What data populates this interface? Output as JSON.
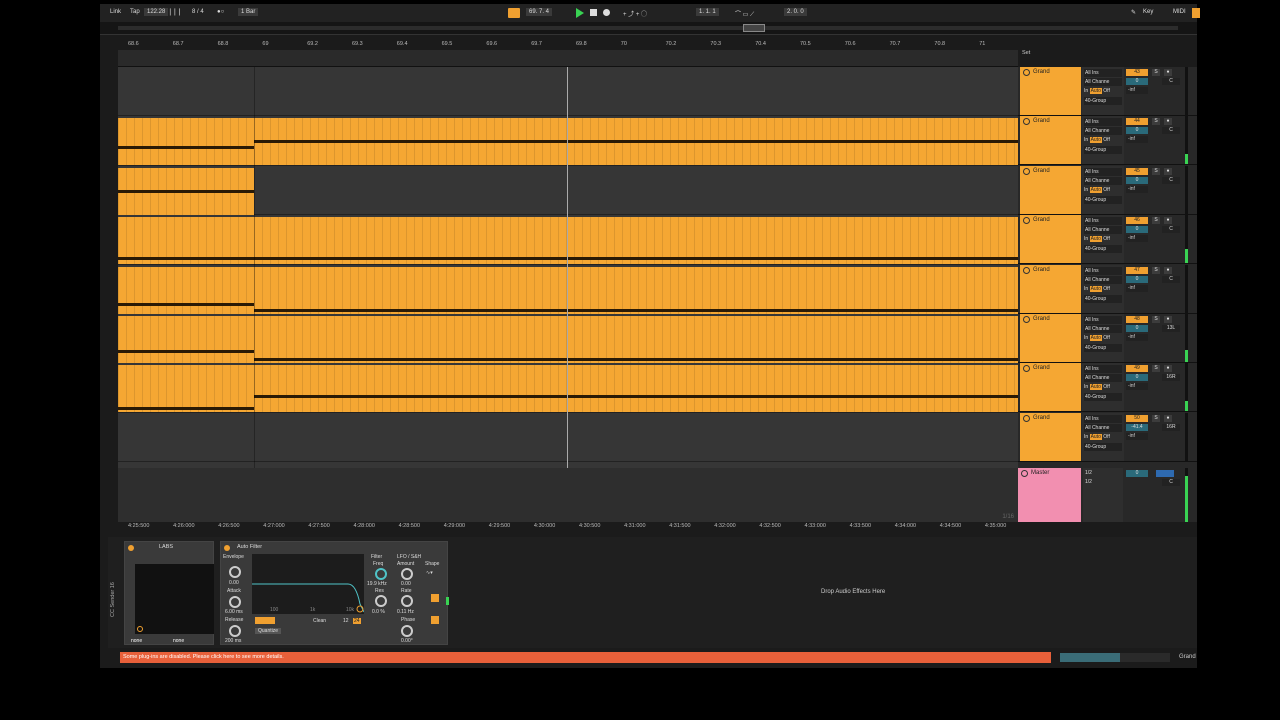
{
  "control_bar": {
    "link": "Link",
    "tap": "Tap",
    "tempo": "122.28",
    "meter_icon": "metronome-icon",
    "time_sig": "8 / 4",
    "quantize": "1 Bar",
    "position": "69.  7.  4",
    "loop_start": "1.  1.  1",
    "loop_len": "2.  0.  0",
    "key": "Key",
    "midi": "MIDI"
  },
  "ruler": {
    "ticks": [
      "68.6",
      "68.7",
      "68.8",
      "69",
      "69.2",
      "69.3",
      "69.4",
      "69.5",
      "69.6",
      "69.7",
      "69.8",
      "70",
      "70.2",
      "70.3",
      "70.4",
      "70.5",
      "70.6",
      "70.7",
      "70.8",
      "71"
    ]
  },
  "time_ruler": {
    "ticks": [
      "4:25:500",
      "4:26:000",
      "4:26:500",
      "4:27:000",
      "4:27:500",
      "4:28:000",
      "4:28:500",
      "4:29:000",
      "4:29:500",
      "4:30:000",
      "4:30:500",
      "4:31:000",
      "4:31:500",
      "4:32:000",
      "4:32:500",
      "4:33:000",
      "4:33:500",
      "4:34:000",
      "4:34:500",
      "4:35:000"
    ]
  },
  "set_label": "Set",
  "tracks": [
    {
      "name": "Grand",
      "input": "All Ins",
      "channel": "All Channe",
      "monitor_in": "In",
      "monitor_auto": "Auto",
      "monitor_off": "Off",
      "output": "40-Group",
      "number": "43",
      "volume": "0",
      "send": "-inf",
      "pan": "C"
    },
    {
      "name": "Grand",
      "input": "All Ins",
      "channel": "All Channe",
      "monitor_in": "In",
      "monitor_auto": "Auto",
      "monitor_off": "Off",
      "output": "40-Group",
      "number": "44",
      "volume": "0",
      "send": "-inf",
      "pan": "C"
    },
    {
      "name": "Grand",
      "input": "All Ins",
      "channel": "All Channe",
      "monitor_in": "In",
      "monitor_auto": "Auto",
      "monitor_off": "Off",
      "output": "40-Group",
      "number": "45",
      "volume": "0",
      "send": "-inf",
      "pan": "C"
    },
    {
      "name": "Grand",
      "input": "All Ins",
      "channel": "All Channe",
      "monitor_in": "In",
      "monitor_auto": "Auto",
      "monitor_off": "Off",
      "output": "40-Group",
      "number": "46",
      "volume": "0",
      "send": "-inf",
      "pan": "C"
    },
    {
      "name": "Grand",
      "input": "All Ins",
      "channel": "All Channe",
      "monitor_in": "In",
      "monitor_auto": "Auto",
      "monitor_off": "Off",
      "output": "40-Group",
      "number": "47",
      "volume": "0",
      "send": "-inf",
      "pan": "C"
    },
    {
      "name": "Grand",
      "input": "All Ins",
      "channel": "All Channe",
      "monitor_in": "In",
      "monitor_auto": "Auto",
      "monitor_off": "Off",
      "output": "40-Group",
      "number": "48",
      "volume": "0",
      "send": "-inf",
      "pan": "13L"
    },
    {
      "name": "Grand",
      "input": "All Ins",
      "channel": "All Channe",
      "monitor_in": "In",
      "monitor_auto": "Auto",
      "monitor_off": "Off",
      "output": "40-Group",
      "number": "49",
      "volume": "0",
      "send": "-inf",
      "pan": "16R"
    },
    {
      "name": "Grand",
      "input": "All Ins",
      "channel": "All Channe",
      "monitor_in": "In",
      "monitor_auto": "Auto",
      "monitor_off": "Off",
      "output": "40-Group",
      "number": "50",
      "volume": "-41.4",
      "send": "-inf",
      "pan": "16R"
    }
  ],
  "master": {
    "name": "Master",
    "out1": "1/2",
    "out2": "1/2",
    "volume": "0",
    "pan": "C",
    "page": "1/16"
  },
  "devices": {
    "labs": {
      "title": "LABS",
      "sel1": "none",
      "sel2": "none"
    },
    "side_label": "CC Sender 16",
    "auto_filter": {
      "title": "Auto Filter",
      "envelope": "Envelope",
      "env_amount": "0.00",
      "attack_label": "Attack",
      "attack": "6.00 ms",
      "release_label": "Release",
      "release": "200 ms",
      "graph_ticks": [
        "100",
        "1k",
        "10k"
      ],
      "filter": "Filter",
      "freq_label": "Freq",
      "freq": "19.9 kHz",
      "res_label": "Res",
      "res": "0.0 %",
      "lfo": "LFO / S&H",
      "amount_label": "Amount",
      "amount": "0.00",
      "rate_label": "Rate",
      "rate": "0.11 Hz",
      "phase_label": "Phase",
      "phase": "0.00°",
      "shape_label": "Shape",
      "mode": "Clean",
      "slope1": "12",
      "slope2": "24",
      "quantize": "Quantize"
    },
    "drop_msg": "Drop Audio Effects Here"
  },
  "status": {
    "warning": "Some plug-ins are disabled. Please click here to see more details.",
    "current_track": "Grand"
  }
}
